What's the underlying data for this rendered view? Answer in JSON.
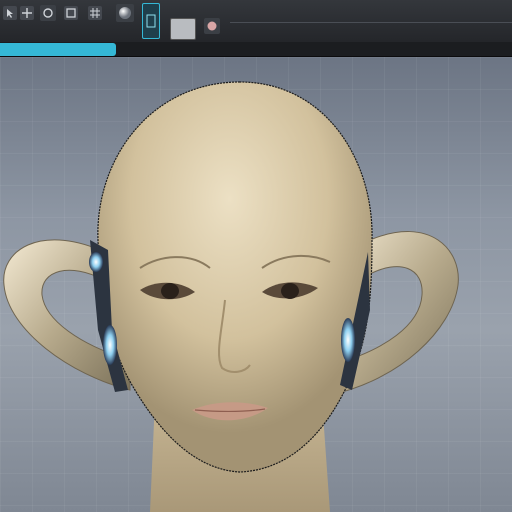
{
  "toolbar": {
    "icons": [
      "select-icon",
      "move-icon",
      "rotate-icon",
      "scale-icon",
      "sphere-icon",
      "render-icon",
      "material-swatch-icon",
      "light-icon"
    ]
  },
  "tabs": {
    "active_label": ""
  },
  "viewport": {
    "object_name": "",
    "status_text": ""
  },
  "colors": {
    "accent": "#35b8d6",
    "toolbar_bg": "#2b2e33",
    "viewport_bg": "#8d96a3",
    "skin": "#d9c7a3",
    "chrome": "#cfc4a8"
  }
}
